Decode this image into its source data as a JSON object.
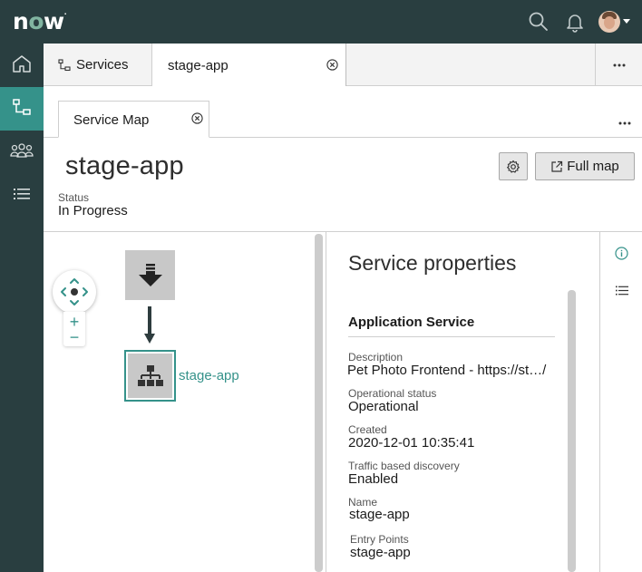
{
  "header": {
    "logo_text": "now",
    "icons": [
      "search-icon",
      "bell-icon",
      "avatar"
    ]
  },
  "rail": {
    "items": [
      {
        "icon": "home-icon"
      },
      {
        "icon": "service-map-icon",
        "active": true
      },
      {
        "icon": "users-icon"
      },
      {
        "icon": "list-icon"
      }
    ]
  },
  "tabs": {
    "items": [
      {
        "label": "Services",
        "icon": "service-map-icon"
      },
      {
        "label": "stage-app",
        "active": true,
        "closable": true
      }
    ],
    "more_label": "…"
  },
  "subtabs": {
    "items": [
      {
        "label": "Service Map",
        "closable": true
      }
    ]
  },
  "page": {
    "title": "stage-app",
    "status_label": "Status",
    "status_value": "In Progress",
    "full_map_label": "Full map"
  },
  "map": {
    "node_label": "stage-app",
    "zoom_in": "+",
    "zoom_out": "−"
  },
  "properties": {
    "title": "Service properties",
    "section": "Application Service",
    "fields": [
      {
        "label": "Description",
        "value": "Pet Photo Frontend  - https://st…/"
      },
      {
        "label": "Operational status",
        "value": "Operational"
      },
      {
        "label": "Created",
        "value": "2020-12-01 10:35:41"
      },
      {
        "label": "Traffic based discovery",
        "value": "Enabled"
      },
      {
        "label": "Name",
        "value": "stage-app"
      },
      {
        "label": "Entry Points",
        "value": "stage-app"
      }
    ]
  },
  "colors": {
    "header_bg": "#293e40",
    "accent": "#35928a",
    "logo_o": "#81b5a1"
  }
}
